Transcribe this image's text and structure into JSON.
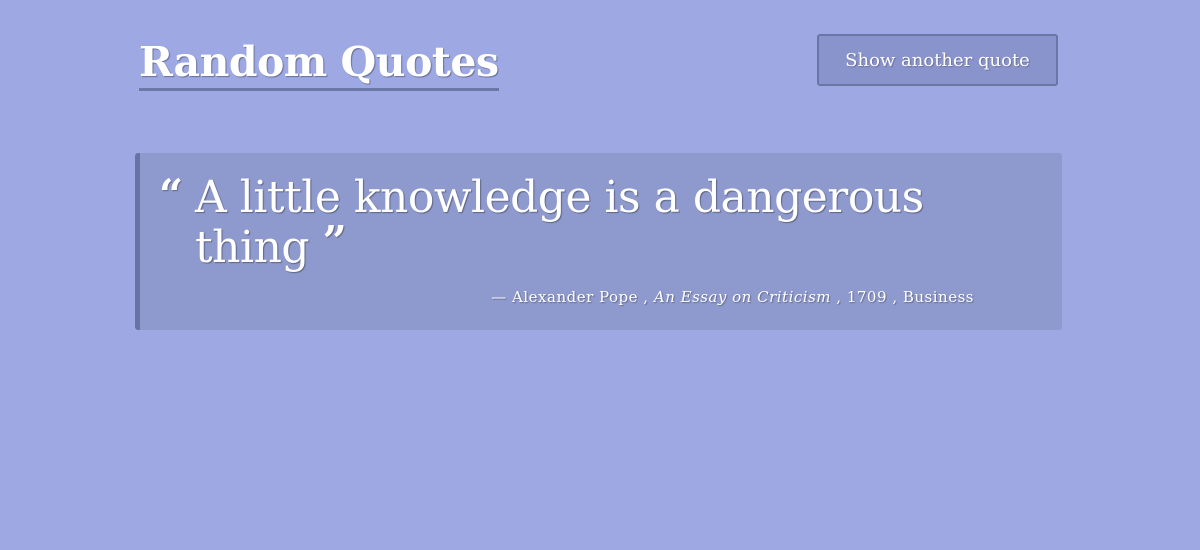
{
  "header": {
    "title": "Random Quotes",
    "button_label": "Show another quote"
  },
  "quote": {
    "open_mark": "“",
    "text": "A little knowledge is a dangerous thing",
    "close_mark": "”",
    "dash": "—",
    "source": "Alexander Pope",
    "citation": "An Essay on Criticism",
    "year": "1709",
    "tag": "Business",
    "separator": ","
  },
  "colors": {
    "background": "#9ea9e4",
    "quote_box": "#8e99cd",
    "accent_border": "#6a72a4",
    "button": "#8a94cc"
  }
}
